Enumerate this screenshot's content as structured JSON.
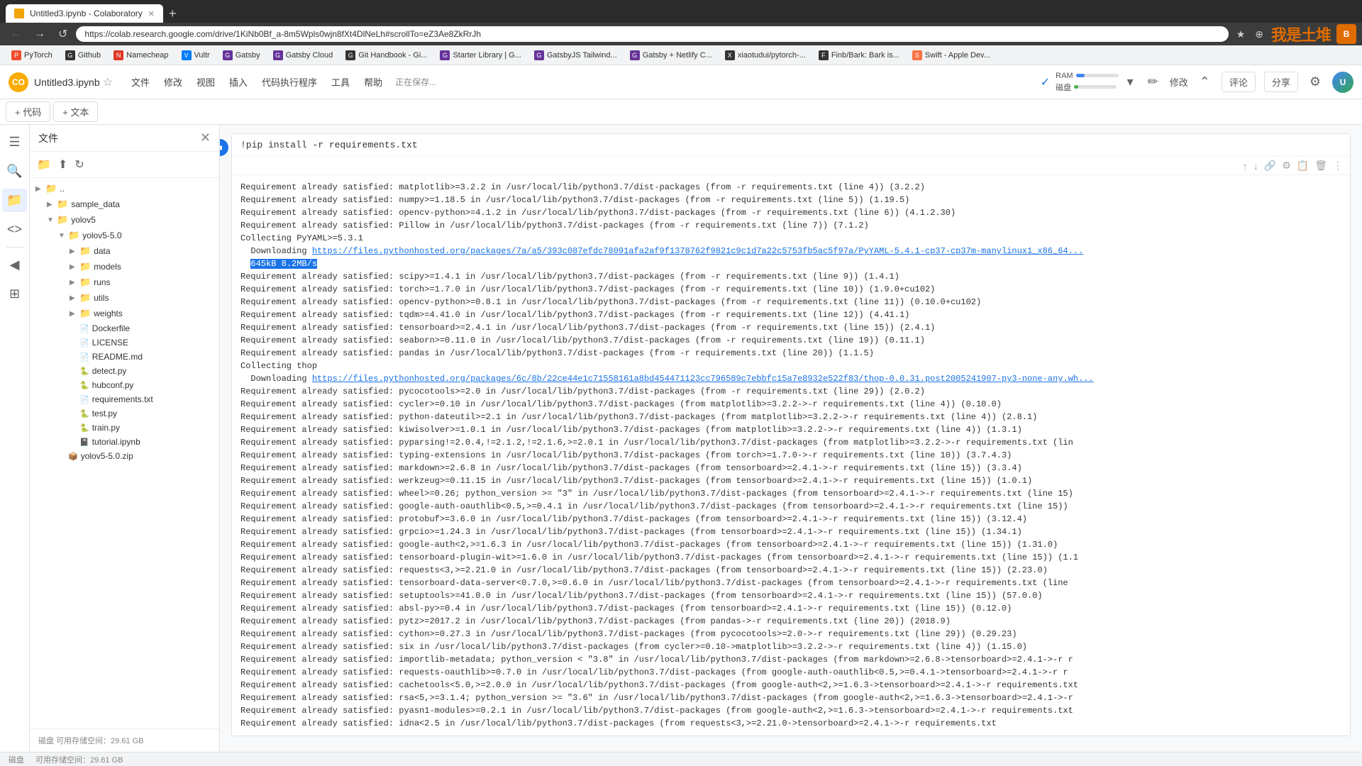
{
  "browser": {
    "tab_title": "Untitled3.ipynb - Colaboratory",
    "tab_icon_color": "#f1a500",
    "address_url": "https://colab.research.google.com/drive/1KiNb0Bf_a-8m5Wpls0wjn8fXt4DlNeLh#scrollTo=eZ3Ae8ZkRrJh",
    "new_tab_label": "+",
    "back_btn": "←",
    "forward_btn": "→",
    "refresh_btn": "↺",
    "home_btn": "🏠"
  },
  "bookmarks": [
    {
      "label": "PyTorch",
      "icon_color": "#ee4c2c",
      "icon_text": "P"
    },
    {
      "label": "Github",
      "icon_color": "#333",
      "icon_text": "G"
    },
    {
      "label": "Namecheap",
      "icon_color": "#de3723",
      "icon_text": "N"
    },
    {
      "label": "Vultr",
      "icon_color": "#007bfc",
      "icon_text": "V"
    },
    {
      "label": "Gatsby",
      "icon_color": "#663399",
      "icon_text": "G"
    },
    {
      "label": "Gatsby Cloud",
      "icon_color": "#663399",
      "icon_text": "G"
    },
    {
      "label": "Git Handbook - Gi...",
      "icon_color": "#333",
      "icon_text": "G"
    },
    {
      "label": "Starter Library | G...",
      "icon_color": "#663399",
      "icon_text": "G"
    },
    {
      "label": "GatsbyJS Tailwind...",
      "icon_color": "#663399",
      "icon_text": "G"
    },
    {
      "label": "Gatsby + Netlify C...",
      "icon_color": "#663399",
      "icon_text": "G"
    },
    {
      "label": "xiaotudui/pytorch-...",
      "icon_color": "#333",
      "icon_text": "X"
    },
    {
      "label": "Finb/Bark: Bark is...",
      "icon_color": "#333",
      "icon_text": "F"
    },
    {
      "label": "Swift - Apple Dev...",
      "icon_color": "#fa7343",
      "icon_text": "S"
    }
  ],
  "colab": {
    "logo_text": "CO",
    "filename": "Untitled3.ipynb",
    "star_icon": "☆",
    "menu_items": [
      "文件",
      "修改",
      "视图",
      "插入",
      "代码执行程序",
      "工具",
      "帮助"
    ],
    "saving_text": "正在保存...",
    "ram_label": "RAM",
    "disk_label": "磁盘",
    "edit_btn": "✏",
    "expand_btn": "⌃",
    "add_code_label": "+ 代码",
    "add_text_label": "+ 文本",
    "connect_btn": "修改",
    "comment_label": "评论",
    "share_label": "分享"
  },
  "sidebar": {
    "title": "文件",
    "close_icon": "✕",
    "tree": [
      {
        "label": "..",
        "type": "folder",
        "indent": 0,
        "expanded": false
      },
      {
        "label": "sample_data",
        "type": "folder",
        "indent": 1,
        "expanded": false
      },
      {
        "label": "yolov5",
        "type": "folder",
        "indent": 1,
        "expanded": true
      },
      {
        "label": "yolov5-5.0",
        "type": "folder",
        "indent": 2,
        "expanded": true
      },
      {
        "label": "data",
        "type": "folder",
        "indent": 3,
        "expanded": false
      },
      {
        "label": "models",
        "type": "folder",
        "indent": 3,
        "expanded": false
      },
      {
        "label": "runs",
        "type": "folder",
        "indent": 3,
        "expanded": false
      },
      {
        "label": "utils",
        "type": "folder",
        "indent": 3,
        "expanded": false
      },
      {
        "label": "weights",
        "type": "folder",
        "indent": 3,
        "expanded": false
      },
      {
        "label": "Dockerfile",
        "type": "file",
        "indent": 3
      },
      {
        "label": "LICENSE",
        "type": "file",
        "indent": 3
      },
      {
        "label": "README.md",
        "type": "file",
        "indent": 3
      },
      {
        "label": "detect.py",
        "type": "file-py",
        "indent": 3
      },
      {
        "label": "hubconf.py",
        "type": "file-py",
        "indent": 3
      },
      {
        "label": "requirements.txt",
        "type": "file-txt",
        "indent": 3
      },
      {
        "label": "test.py",
        "type": "file-py",
        "indent": 3
      },
      {
        "label": "train.py",
        "type": "file-py",
        "indent": 3
      },
      {
        "label": "tutorial.ipynb",
        "type": "file-ipynb",
        "indent": 3
      },
      {
        "label": "yolov5-5.0.zip",
        "type": "file-zip",
        "indent": 2
      }
    ],
    "storage_label": "磁盘",
    "storage_text": "可用存储空间：29.61 GB"
  },
  "cell": {
    "command": "!pip install -r requirements.txt",
    "toolbar_btns": [
      "↑",
      "↓",
      "🔗",
      "⚙",
      "📋",
      "🗑",
      "⋮"
    ]
  },
  "output": {
    "lines": [
      "Requirement already satisfied: matplotlib>=3.2.2 in /usr/local/lib/python3.7/dist-packages (from -r requirements.txt (line 4)) (3.2.2)",
      "Requirement already satisfied: numpy>=1.18.5 in /usr/local/lib/python3.7/dist-packages (from -r requirements.txt (line 5)) (1.19.5)",
      "Requirement already satisfied: opencv-python>=4.1.2 in /usr/local/lib/python3.7/dist-packages (from -r requirements.txt (line 6)) (4.1.2.30)",
      "Requirement already satisfied: Pillow in /usr/local/lib/python3.7/dist-packages (from -r requirements.txt (line 7)) (7.1.2)",
      "Collecting PyYAML>=5.3.1",
      "  Downloading https://files.pythonhosted.org/packages/7a/a5/393c087efdc78091afa2af9f1378762f9821c9c1d7a22c5753fb5ac5f97a/PyYAML-5.4.1-cp37-cp37m-manylinux1_x86_64...  645kB 8.2MB/s",
      "Requirement already satisfied: scipy>=1.4.1 in /usr/local/lib/python3.7/dist-packages (from -r requirements.txt (line 9)) (1.4.1)",
      "Requirement already satisfied: torch>=1.7.0 in /usr/local/lib/python3.7/dist-packages (from -r requirements.txt (line 10)) (1.9.0+cu102)",
      "Requirement already satisfied: opencv-python>=0.8.1 in /usr/local/lib/python3.7/dist-packages (from -r requirements.txt (line 11)) (0.10.0+cu102)",
      "Requirement already satisfied: tqdm>=4.41.0 in /usr/local/lib/python3.7/dist-packages (from -r requirements.txt (line 12)) (4.41.1)",
      "Requirement already satisfied: tensorboard>=2.4.1 in /usr/local/lib/python3.7/dist-packages (from -r requirements.txt (line 15)) (2.4.1)",
      "Requirement already satisfied: seaborn>=0.11.0 in /usr/local/lib/python3.7/dist-packages (from -r requirements.txt (line 19)) (0.11.1)",
      "Requirement already satisfied: pandas in /usr/local/lib/python3.7/dist-packages (from -r requirements.txt (line 20)) (1.1.5)",
      "Collecting thop",
      "  Downloading https://files.pythonhosted.org/packages/6c/8b/22ce44e1c71558161a8bd454471123cc796589c7ebbfc15a7e8932e522f83/thop-0.0.31.post2005241907-py3-none-any.wh...",
      "Requirement already satisfied: pycocotools>=2.0 in /usr/local/lib/python3.7/dist-packages (from -r requirements.txt (line 29)) (2.0.2)",
      "Requirement already satisfied: cycler>=0.10 in /usr/local/lib/python3.7/dist-packages (from matplotlib>=3.2.2->-r requirements.txt (line 4)) (0.10.0)",
      "Requirement already satisfied: python-dateutil>=2.1 in /usr/local/lib/python3.7/dist-packages (from matplotlib>=3.2.2->-r requirements.txt (line 4)) (2.8.1)",
      "Requirement already satisfied: kiwisolver>=1.0.1 in /usr/local/lib/python3.7/dist-packages (from matplotlib>=3.2.2->-r requirements.txt (line 4)) (1.3.1)",
      "Requirement already satisfied: pyparsing!=2.0.4,!=2.1.2,!=2.1.6,>=2.0.1 in /usr/local/lib/python3.7/dist-packages (from matplotlib>=3.2.2->-r requirements.txt (lin",
      "Requirement already satisfied: typing-extensions in /usr/local/lib/python3.7/dist-packages (from torch>=1.7.0->-r requirements.txt (line 10)) (3.7.4.3)",
      "Requirement already satisfied: markdown>=2.6.8 in /usr/local/lib/python3.7/dist-packages (from tensorboard>=2.4.1->-r requirements.txt (line 15)) (3.3.4)",
      "Requirement already satisfied: werkzeug>=0.11.15 in /usr/local/lib/python3.7/dist-packages (from tensorboard>=2.4.1->-r requirements.txt (line 15)) (1.0.1)",
      "Requirement already satisfied: wheel>=0.26; python_version >= \"3\" in /usr/local/lib/python3.7/dist-packages (from tensorboard>=2.4.1->-r requirements.txt (line 15)",
      "Requirement already satisfied: google-auth-oauthlib<0.5,>=0.4.1 in /usr/local/lib/python3.7/dist-packages (from tensorboard>=2.4.1->-r requirements.txt (line 15))",
      "Requirement already satisfied: protobuf>=3.6.0 in /usr/local/lib/python3.7/dist-packages (from tensorboard>=2.4.1->-r requirements.txt (line 15)) (3.12.4)",
      "Requirement already satisfied: grpcio>=1.24.3 in /usr/local/lib/python3.7/dist-packages (from tensorboard>=2.4.1->-r requirements.txt (line 15)) (1.34.1)",
      "Requirement already satisfied: google-auth<2,>=1.6.3 in /usr/local/lib/python3.7/dist-packages (from tensorboard>=2.4.1->-r requirements.txt (line 15)) (1.31.0)",
      "Requirement already satisfied: tensorboard-plugin-wit>=1.6.0 in /usr/local/lib/python3.7/dist-packages (from tensorboard>=2.4.1->-r requirements.txt (line 15)) (1.1",
      "Requirement already satisfied: requests<3,>=2.21.0 in /usr/local/lib/python3.7/dist-packages (from tensorboard>=2.4.1->-r requirements.txt (line 15)) (2.23.0)",
      "Requirement already satisfied: tensorboard-data-server<0.7.0,>=0.6.0 in /usr/local/lib/python3.7/dist-packages (from tensorboard>=2.4.1->-r requirements.txt (line",
      "Requirement already satisfied: setuptools>=41.0.0 in /usr/local/lib/python3.7/dist-packages (from tensorboard>=2.4.1->-r requirements.txt (line 15)) (57.0.0)",
      "Requirement already satisfied: absl-py>=0.4 in /usr/local/lib/python3.7/dist-packages (from tensorboard>=2.4.1->-r requirements.txt (line 15)) (0.12.0)",
      "Requirement already satisfied: pytz>=2017.2 in /usr/local/lib/python3.7/dist-packages (from pandas->-r requirements.txt (line 20)) (2018.9)",
      "Requirement already satisfied: cython>=0.27.3 in /usr/local/lib/python3.7/dist-packages (from pycocotools>=2.0->-r requirements.txt (line 29)) (0.29.23)",
      "Requirement already satisfied: six in /usr/local/lib/python3.7/dist-packages (from cycler>=0.10->matplotlib>=3.2.2->-r requirements.txt (line 4)) (1.15.0)",
      "Requirement already satisfied: importlib-metadata; python_version < \"3.8\" in /usr/local/lib/python3.7/dist-packages (from markdown>=2.6.8->tensorboard>=2.4.1->-r r",
      "Requirement already satisfied: requests-oauthlib>=0.7.0 in /usr/local/lib/python3.7/dist-packages (from google-auth-oauthlib<0.5,>=0.4.1->tensorboard>=2.4.1->-r r",
      "Requirement already satisfied: cachetools<5.0,>=2.0.0 in /usr/local/lib/python3.7/dist-packages (from google-auth<2,>=1.6.3->tensorboard>=2.4.1->-r requirements.txt",
      "Requirement already satisfied: rsa<5,>=3.1.4; python_version >= \"3.6\" in /usr/local/lib/python3.7/dist-packages (from google-auth<2,>=1.6.3->tensorboard>=2.4.1->-r",
      "Requirement already satisfied: pyasn1-modules>=0.2.1 in /usr/local/lib/python3.7/dist-packages (from google-auth<2,>=1.6.3->tensorboard>=2.4.1->-r requirements.txt",
      "Requirement already satisfied: idna<2.5 in /usr/local/lib/python3.7/dist-packages (from requests<3,>=2.21.0->tensorboard>=2.4.1->-r requirements.txt"
    ],
    "download_line1": "  Downloading https://files.pythonhosted.org/packages/7a/a5/393c087efdc78091afa2af9f1378762f9821c9c1d7a22c5753fb5ac5f97a/PyYAML-5.4.1-cp37-cp37m-manylinux1_x86_64...",
    "download_progress": "645kB 8.2MB/s"
  },
  "statusbar": {
    "disk_label": "磁盘",
    "storage_text": "可用存储空间：29.61 GB"
  }
}
